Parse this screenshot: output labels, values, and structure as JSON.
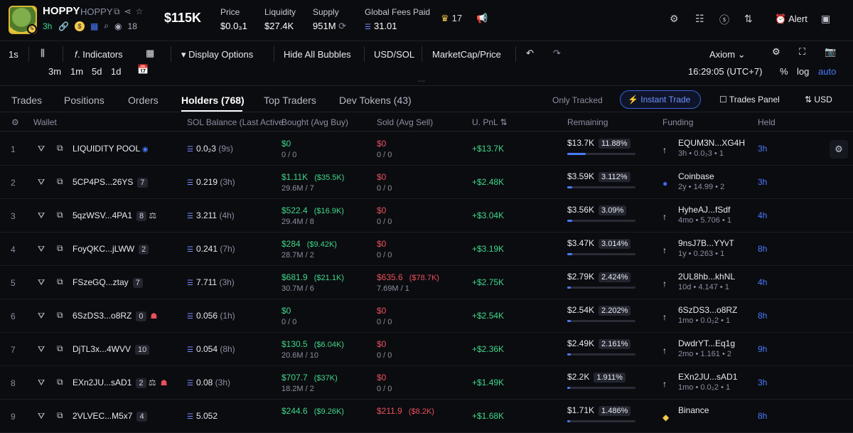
{
  "token": {
    "ticker": "HOPPY",
    "name": "HOPPY",
    "age": "3h",
    "watchers": "18",
    "market_cap": "$115K"
  },
  "stats": [
    {
      "label": "Price",
      "value": "$0.0₃1"
    },
    {
      "label": "Liquidity",
      "value": "$27.4K"
    },
    {
      "label": "Supply",
      "value": "951M"
    },
    {
      "label": "Global Fees Paid",
      "value": "31.01"
    }
  ],
  "crown_count": "17",
  "alert_label": "Alert",
  "toolbar": {
    "interval": "1s",
    "indicators": "Indicators",
    "display_options": "Display Options",
    "hide_bubbles": "Hide All Bubbles",
    "usd": "USD",
    "sol": "/SOL",
    "marketcap": "MarketCap",
    "price": "/Price",
    "axiom": "Axiom",
    "ranges": [
      "3m",
      "1m",
      "5d",
      "1d"
    ],
    "clock": "16:29:05 (UTC+7)",
    "percent": "%",
    "log": "log",
    "auto": "auto"
  },
  "tabs": [
    "Trades",
    "Positions",
    "Orders",
    "Holders (768)",
    "Top Traders",
    "Dev Tokens (43)"
  ],
  "right_controls": {
    "only_tracked": "Only Tracked",
    "instant_trade": "Instant Trade",
    "trades_panel": "Trades Panel",
    "currency": "USD"
  },
  "columns": [
    "Wallet",
    "SOL Balance (Last Active)",
    "Bought (Avg Buy)",
    "Sold (Avg Sell)",
    "U. PnL",
    "Remaining",
    "Funding",
    "Held"
  ],
  "rows": [
    {
      "idx": "1",
      "wallet": "LIQUIDITY POOL",
      "badge": "",
      "bal": "0.0₂3",
      "bal_t": "(9s)",
      "bought": "$0",
      "bought_sub": "0 / 0",
      "bought_avg": "",
      "sold": "$0",
      "sold_sub": "0 / 0",
      "sold_avg": "",
      "pnl": "+$13.7K",
      "rem": "$13.7K",
      "rem_pct": "11.88%",
      "rem_frac": 0.1188,
      "fund_src": "EQUM3N...XG4H",
      "fund_sub": "3h • 0.0₂3 • 1",
      "held": "3h"
    },
    {
      "idx": "2",
      "wallet": "5CP4PS...26YS",
      "badge": "7",
      "bal": "0.219",
      "bal_t": "(3h)",
      "bought": "$1.11K",
      "bought_sub": "29.6M / 7",
      "bought_avg": "($35.5K)",
      "sold": "$0",
      "sold_sub": "0 / 0",
      "sold_avg": "",
      "pnl": "+$2.48K",
      "rem": "$3.59K",
      "rem_pct": "3.112%",
      "rem_frac": 0.0311,
      "fund_src": "Coinbase",
      "fund_sub": "2y • 14.99 • 2",
      "held": "3h"
    },
    {
      "idx": "3",
      "wallet": "5qzWSV...4PA1",
      "badge": "8",
      "bal": "3.211",
      "bal_t": "(4h)",
      "bought": "$522.4",
      "bought_sub": "29.4M / 8",
      "bought_avg": "($16.9K)",
      "sold": "$0",
      "sold_sub": "0 / 0",
      "sold_avg": "",
      "pnl": "+$3.04K",
      "rem": "$3.56K",
      "rem_pct": "3.09%",
      "rem_frac": 0.0309,
      "fund_src": "HyheAJ...fSdf",
      "fund_sub": "4mo • 5.706 • 1",
      "held": "4h"
    },
    {
      "idx": "4",
      "wallet": "FoyQKC...jLWW",
      "badge": "2",
      "bal": "0.241",
      "bal_t": "(7h)",
      "bought": "$284",
      "bought_sub": "28.7M / 2",
      "bought_avg": "($9.42K)",
      "sold": "$0",
      "sold_sub": "0 / 0",
      "sold_avg": "",
      "pnl": "+$3.19K",
      "rem": "$3.47K",
      "rem_pct": "3.014%",
      "rem_frac": 0.0301,
      "fund_src": "9nsJ7B...YYvT",
      "fund_sub": "1y • 0.263 • 1",
      "held": "8h"
    },
    {
      "idx": "5",
      "wallet": "FSzeGQ...ztay",
      "badge": "7",
      "bal": "7.711",
      "bal_t": "(3h)",
      "bought": "$681.9",
      "bought_sub": "30.7M / 6",
      "bought_avg": "($21.1K)",
      "sold": "$635.6",
      "sold_sub": "7.69M / 1",
      "sold_avg": "($78.7K)",
      "pnl": "+$2.75K",
      "rem": "$2.79K",
      "rem_pct": "2.424%",
      "rem_frac": 0.0242,
      "fund_src": "2UL8hb...khNL",
      "fund_sub": "10d • 4.147 • 1",
      "held": "4h"
    },
    {
      "idx": "6",
      "wallet": "6SzDS3...o8RZ",
      "badge": "0",
      "bal": "0.056",
      "bal_t": "(1h)",
      "bought": "$0",
      "bought_sub": "0 / 0",
      "bought_avg": "",
      "sold": "$0",
      "sold_sub": "0 / 0",
      "sold_avg": "",
      "pnl": "+$2.54K",
      "rem": "$2.54K",
      "rem_pct": "2.202%",
      "rem_frac": 0.022,
      "fund_src": "6SzDS3...o8RZ",
      "fund_sub": "1mo • 0.0₂2 • 1",
      "held": "8h"
    },
    {
      "idx": "7",
      "wallet": "DjTL3x...4WVV",
      "badge": "10",
      "bal": "0.054",
      "bal_t": "(8h)",
      "bought": "$130.5",
      "bought_sub": "20.6M / 10",
      "bought_avg": "($6.04K)",
      "sold": "$0",
      "sold_sub": "0 / 0",
      "sold_avg": "",
      "pnl": "+$2.36K",
      "rem": "$2.49K",
      "rem_pct": "2.161%",
      "rem_frac": 0.0216,
      "fund_src": "DwdrYT...Eq1g",
      "fund_sub": "2mo • 1.161 • 2",
      "held": "9h"
    },
    {
      "idx": "8",
      "wallet": "EXn2JU...sAD1",
      "badge": "2",
      "bal": "0.08",
      "bal_t": "(3h)",
      "bought": "$707.7",
      "bought_sub": "18.2M / 2",
      "bought_avg": "($37K)",
      "sold": "$0",
      "sold_sub": "0 / 0",
      "sold_avg": "",
      "pnl": "+$1.49K",
      "rem": "$2.2K",
      "rem_pct": "1.911%",
      "rem_frac": 0.0191,
      "fund_src": "EXn2JU...sAD1",
      "fund_sub": "1mo • 0.0₂2 • 1",
      "held": "3h"
    },
    {
      "idx": "9",
      "wallet": "2VLVEC...M5x7",
      "badge": "4",
      "bal": "5.052",
      "bal_t": "",
      "bought": "$244.6",
      "bought_sub": "",
      "bought_avg": "($9.26K)",
      "sold": "$211.9",
      "sold_sub": "",
      "sold_avg": "($8.2K)",
      "pnl": "+$1.68K",
      "rem": "$1.71K",
      "rem_pct": "1.486%",
      "rem_frac": 0.0149,
      "fund_src": "Binance",
      "fund_sub": "",
      "held": "8h"
    }
  ]
}
